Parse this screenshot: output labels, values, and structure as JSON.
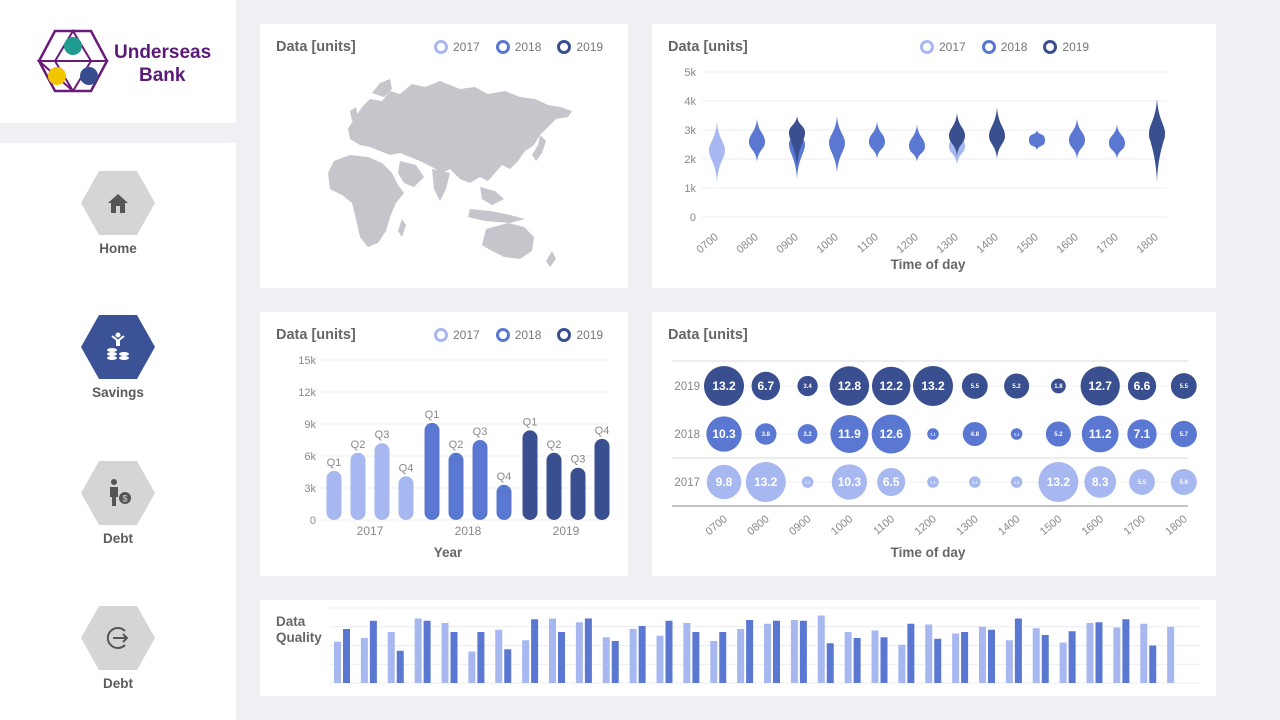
{
  "brand": {
    "name_line1": "Underseas",
    "name_line2": "Bank",
    "logo_colors": {
      "frame": "#6a1b7a",
      "teal": "#1f9c8f",
      "yellow": "#f2c500",
      "navy": "#364c8f"
    }
  },
  "nav": [
    {
      "label": "Home",
      "icon": "home-icon",
      "active": false
    },
    {
      "label": "Savings",
      "icon": "savings-icon",
      "active": true
    },
    {
      "label": "Debt",
      "icon": "debt-person-icon",
      "active": false
    },
    {
      "label": "Debt",
      "icon": "logout-icon",
      "active": false
    }
  ],
  "colors": {
    "y2017": "#a7b8f0",
    "y2018": "#5a78d2",
    "y2019": "#3a4f8f",
    "map": "#c5c5cb",
    "active_nav": "#3b5396",
    "inactive_nav": "#d5d5d8"
  },
  "legend": [
    "2017",
    "2018",
    "2019"
  ],
  "cards": {
    "map": {
      "title": "Data [units]"
    },
    "violin": {
      "title": "Data [units]"
    },
    "bars": {
      "title": "Data [units]"
    },
    "bubble": {
      "title": "Data [units]"
    },
    "quality": {
      "title_line1": "Data",
      "title_line2": "Quality"
    }
  },
  "chart_data": [
    {
      "type": "violin",
      "title": "Data [units]",
      "xlabel": "Time of day",
      "ylabel": "",
      "categories": [
        "0700",
        "0800",
        "0900",
        "1000",
        "1100",
        "1200",
        "1300",
        "1400",
        "1500",
        "1600",
        "1700",
        "1800"
      ],
      "yticks": [
        "0",
        "1k",
        "2k",
        "3k",
        "4k",
        "5k"
      ],
      "ylim": [
        0,
        5000
      ],
      "series": [
        {
          "name": "2017",
          "points": [
            {
              "x": "0700",
              "median": 2300,
              "min": 1200,
              "max": 3300
            },
            {
              "x": "1300",
              "median": 2450,
              "min": 1800,
              "max": 3100
            }
          ]
        },
        {
          "name": "2018",
          "points": [
            {
              "x": "0800",
              "median": 2600,
              "min": 1900,
              "max": 3400
            },
            {
              "x": "0900",
              "median": 2500,
              "min": 1300,
              "max": 3000
            },
            {
              "x": "1000",
              "median": 2550,
              "min": 1500,
              "max": 3500
            },
            {
              "x": "1100",
              "median": 2600,
              "min": 2000,
              "max": 3300
            },
            {
              "x": "1200",
              "median": 2450,
              "min": 1900,
              "max": 3200
            },
            {
              "x": "1500",
              "median": 2650,
              "min": 2300,
              "max": 3000
            },
            {
              "x": "1600",
              "median": 2650,
              "min": 2000,
              "max": 3400
            },
            {
              "x": "1700",
              "median": 2550,
              "min": 2000,
              "max": 3200
            },
            {
              "x": "1800",
              "median": 2800,
              "min": 2400,
              "max": 3200
            }
          ]
        },
        {
          "name": "2019",
          "points": [
            {
              "x": "0900",
              "median": 2900,
              "min": 1700,
              "max": 3500
            },
            {
              "x": "1300",
              "median": 2800,
              "min": 2100,
              "max": 3600
            },
            {
              "x": "1400",
              "median": 2800,
              "min": 2000,
              "max": 3800
            },
            {
              "x": "1800",
              "median": 2900,
              "min": 1200,
              "max": 4100
            }
          ]
        }
      ]
    },
    {
      "type": "bar",
      "title": "Data [units]",
      "xlabel": "Year",
      "ylabel": "",
      "categories": [
        "2017",
        "2018",
        "2019"
      ],
      "quarters": [
        "Q1",
        "Q2",
        "Q3",
        "Q4"
      ],
      "yticks": [
        "0",
        "3k",
        "6k",
        "9k",
        "12k",
        "15k"
      ],
      "ylim": [
        0,
        15000
      ],
      "series": [
        {
          "name": "2017",
          "values": [
            4600,
            6300,
            7200,
            4100
          ]
        },
        {
          "name": "2018",
          "values": [
            9100,
            6300,
            7500,
            3300
          ]
        },
        {
          "name": "2019",
          "values": [
            8400,
            6300,
            4900,
            7600
          ]
        }
      ]
    },
    {
      "type": "bubble",
      "title": "Data [units]",
      "xlabel": "Time of day",
      "categories": [
        "0700",
        "0800",
        "0900",
        "1000",
        "1100",
        "1200",
        "1300",
        "1400",
        "1500",
        "1600",
        "1700",
        "1800"
      ],
      "rows": [
        {
          "name": "2019",
          "values": [
            13.2,
            6.7,
            3.4,
            12.8,
            12.2,
            13.2,
            5.5,
            5.2,
            1.8,
            12.7,
            6.6,
            5.5
          ]
        },
        {
          "name": "2018",
          "values": [
            10.3,
            3.8,
            3.2,
            11.9,
            12.6,
            1.1,
            4.8,
            1.1,
            5.2,
            11.2,
            7.1,
            5.7
          ]
        },
        {
          "name": "2017",
          "values": [
            9.8,
            13.2,
            1.1,
            10.3,
            6.5,
            1.1,
            1.1,
            1.1,
            13.2,
            8.3,
            5.5,
            5.6
          ]
        }
      ]
    },
    {
      "type": "bar",
      "title": "Data Quality",
      "series": [
        {
          "name": "2017",
          "values": [
            55,
            60,
            68,
            86,
            80,
            42,
            71,
            57,
            86,
            81,
            61,
            72,
            63,
            80,
            56,
            72,
            79,
            84,
            90,
            68,
            70,
            51,
            78,
            66,
            75,
            57,
            73,
            54,
            80,
            74,
            79,
            75
          ]
        },
        {
          "name": "2018",
          "values": [
            72,
            83,
            43,
            83,
            68,
            68,
            45,
            85,
            68,
            86,
            56,
            76,
            83,
            68,
            68,
            84,
            83,
            83,
            53,
            60,
            61,
            79,
            59,
            68,
            71,
            86,
            64,
            69,
            81,
            85,
            50,
            0
          ]
        },
        {
          "name": "2019",
          "values": [
            0,
            0,
            0,
            0,
            0,
            0,
            0,
            0,
            0,
            0,
            0,
            0,
            0,
            0,
            0,
            0,
            0,
            0,
            0,
            0,
            0,
            0,
            0,
            0,
            0,
            0,
            0,
            0,
            0,
            0,
            0,
            0
          ]
        }
      ]
    }
  ]
}
